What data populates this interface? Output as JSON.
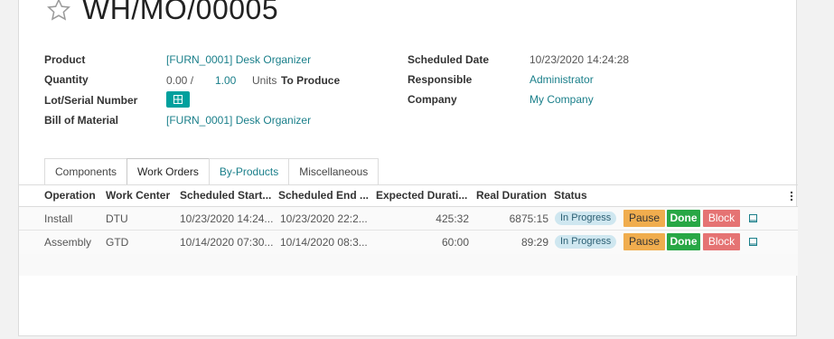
{
  "record": {
    "title": "WH/MO/00005"
  },
  "left_fields": {
    "product_label": "Product",
    "product_value": "[FURN_0001] Desk Organizer",
    "quantity_label": "Quantity",
    "quantity_produced": "0.00 /",
    "quantity_target": "1.00",
    "quantity_unit": "Units",
    "quantity_suffix": "To Produce",
    "lot_label": "Lot/Serial Number",
    "bom_label": "Bill of Material",
    "bom_value": "[FURN_0001] Desk Organizer"
  },
  "right_fields": {
    "scheduled_label": "Scheduled Date",
    "scheduled_value": "10/23/2020 14:24:28",
    "responsible_label": "Responsible",
    "responsible_value": "Administrator",
    "company_label": "Company",
    "company_value": "My Company"
  },
  "tabs": [
    {
      "label": "Components"
    },
    {
      "label": "Work Orders"
    },
    {
      "label": "By-Products"
    },
    {
      "label": "Miscellaneous"
    }
  ],
  "table": {
    "headers": {
      "operation": "Operation",
      "work_center": "Work Center",
      "scheduled_start": "Scheduled Start...",
      "scheduled_end": "Scheduled End ...",
      "expected_duration": "Expected Durati...",
      "real_duration": "Real Duration",
      "status": "Status"
    },
    "rows": [
      {
        "operation": "Install",
        "work_center": "DTU",
        "scheduled_start": "10/23/2020 14:24...",
        "scheduled_end": "10/23/2020 22:2...",
        "expected_duration": "425:32",
        "real_duration": "6875:15",
        "status": "In Progress",
        "pause": "Pause",
        "done": "Done",
        "block": "Block"
      },
      {
        "operation": "Assembly",
        "work_center": "GTD",
        "scheduled_start": "10/14/2020 07:30...",
        "scheduled_end": "10/14/2020 08:3...",
        "expected_duration": "60:00",
        "real_duration": "89:29",
        "status": "In Progress",
        "pause": "Pause",
        "done": "Done",
        "block": "Block"
      }
    ]
  },
  "colors": {
    "link": "#1a7f8a",
    "primary": "#00a09d",
    "pause": "#f0ad4e",
    "done": "#28a745",
    "block": "#e57373",
    "status_bg": "#cfe7f0"
  },
  "icons": {
    "favorite": "star-icon",
    "lot": "grid-icon",
    "tablet": "tablet-icon",
    "options": "kebab-icon"
  }
}
